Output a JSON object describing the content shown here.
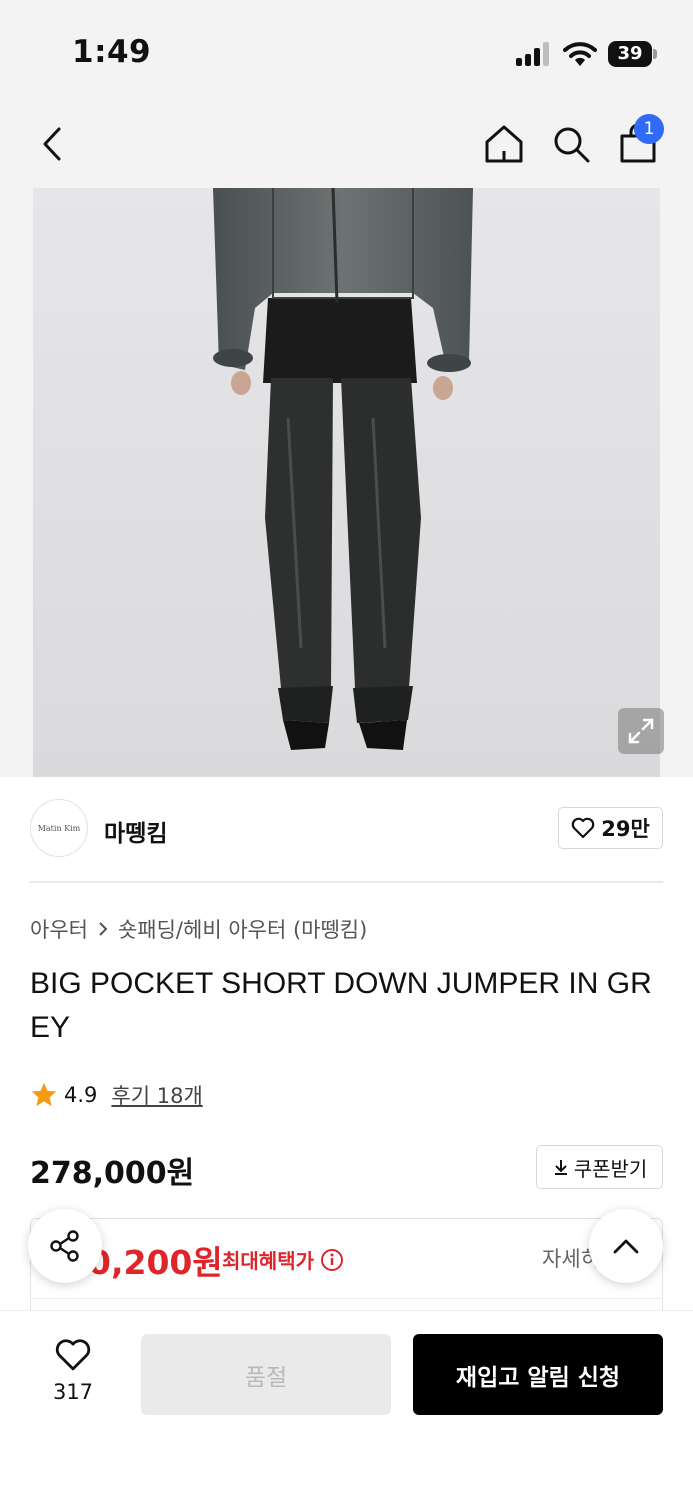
{
  "status_bar": {
    "time": "1:49",
    "battery": "39"
  },
  "nav": {
    "cart_count": "1"
  },
  "brand": {
    "logo_text": "Matin Kim",
    "name": "마뗑킴",
    "like_count": "29만"
  },
  "breadcrumb": {
    "category": "아우터",
    "subcategory": "숏패딩/헤비 아우터 (마뗑킴)"
  },
  "product": {
    "title": "BIG POCKET SHORT DOWN JUMPER IN GREY",
    "rating": "4.9",
    "reviews_label": "후기 18개",
    "price": "278,000원",
    "coupon_label": "쿠폰받기"
  },
  "benefit": {
    "price": "0,200원",
    "label": "최대혜택가",
    "detail": "자세히"
  },
  "bottom": {
    "wish_count": "317",
    "soldout_label": "품절",
    "restock_label": "재입고 알림 신청"
  },
  "colors": {
    "accent_red": "#e0252a",
    "badge_blue": "#2f6bf6",
    "primary_button": "#000000"
  },
  "icons": [
    "back-icon",
    "home-icon",
    "search-icon",
    "cart-icon",
    "expand-icon",
    "heart-icon",
    "star-icon",
    "download-icon",
    "info-icon",
    "share-icon",
    "chevron-up-icon"
  ]
}
